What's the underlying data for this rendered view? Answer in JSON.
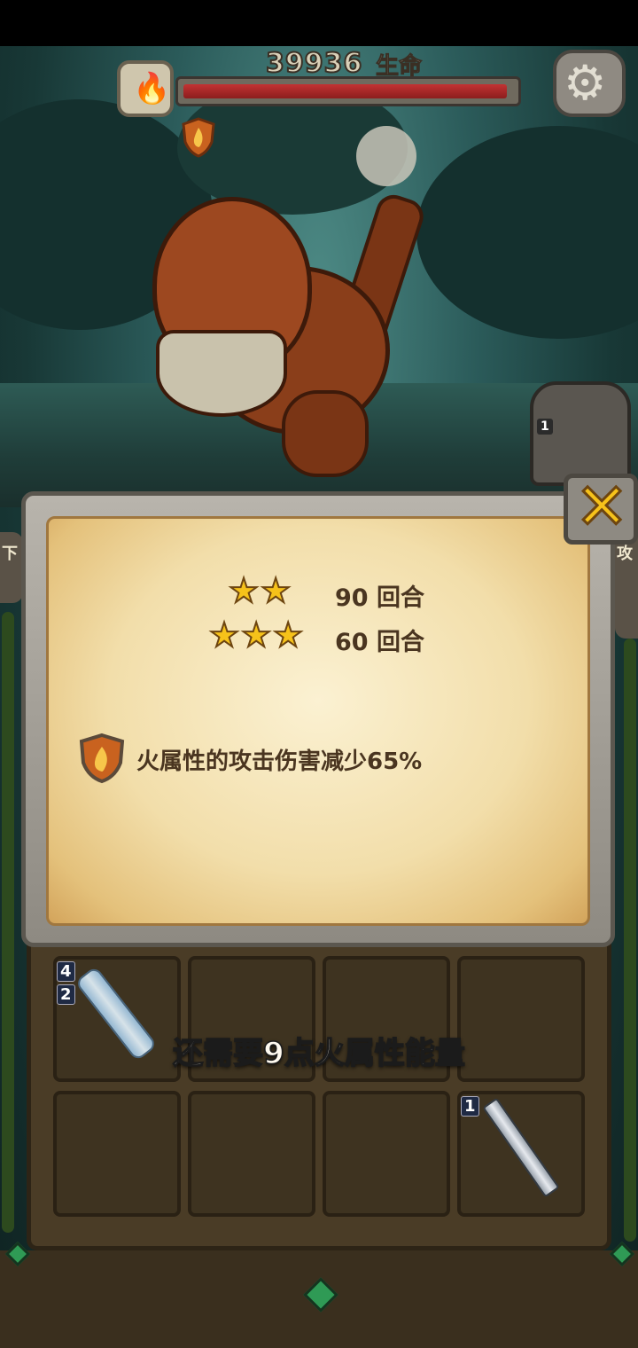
{
  "boss": {
    "hp_value": "39936",
    "hp_label": "生命",
    "hp_fraction": 0.98,
    "element_icon": "fire-icon",
    "resistance_icon": "fire-shield-icon"
  },
  "side_tabs": {
    "left_label": "下",
    "right_label": "攻"
  },
  "dialog": {
    "star_ratings": [
      {
        "stars": 2,
        "turns": "90 回合"
      },
      {
        "stars": 3,
        "turns": "60 回合"
      }
    ],
    "effect_text": "火属性的攻击伤害减少65%",
    "close_icon": "close-x-icon"
  },
  "board": {
    "hint_text": "还需要9点火属性能量",
    "slot_1_badge_top": "4",
    "slot_1_badge_bottom": "2",
    "slot_8_badge": "1",
    "owl_badge": "1"
  },
  "colors": {
    "hp_bar": "#c23333",
    "star": "#f6c21a",
    "parchment": "#f2deaa"
  }
}
